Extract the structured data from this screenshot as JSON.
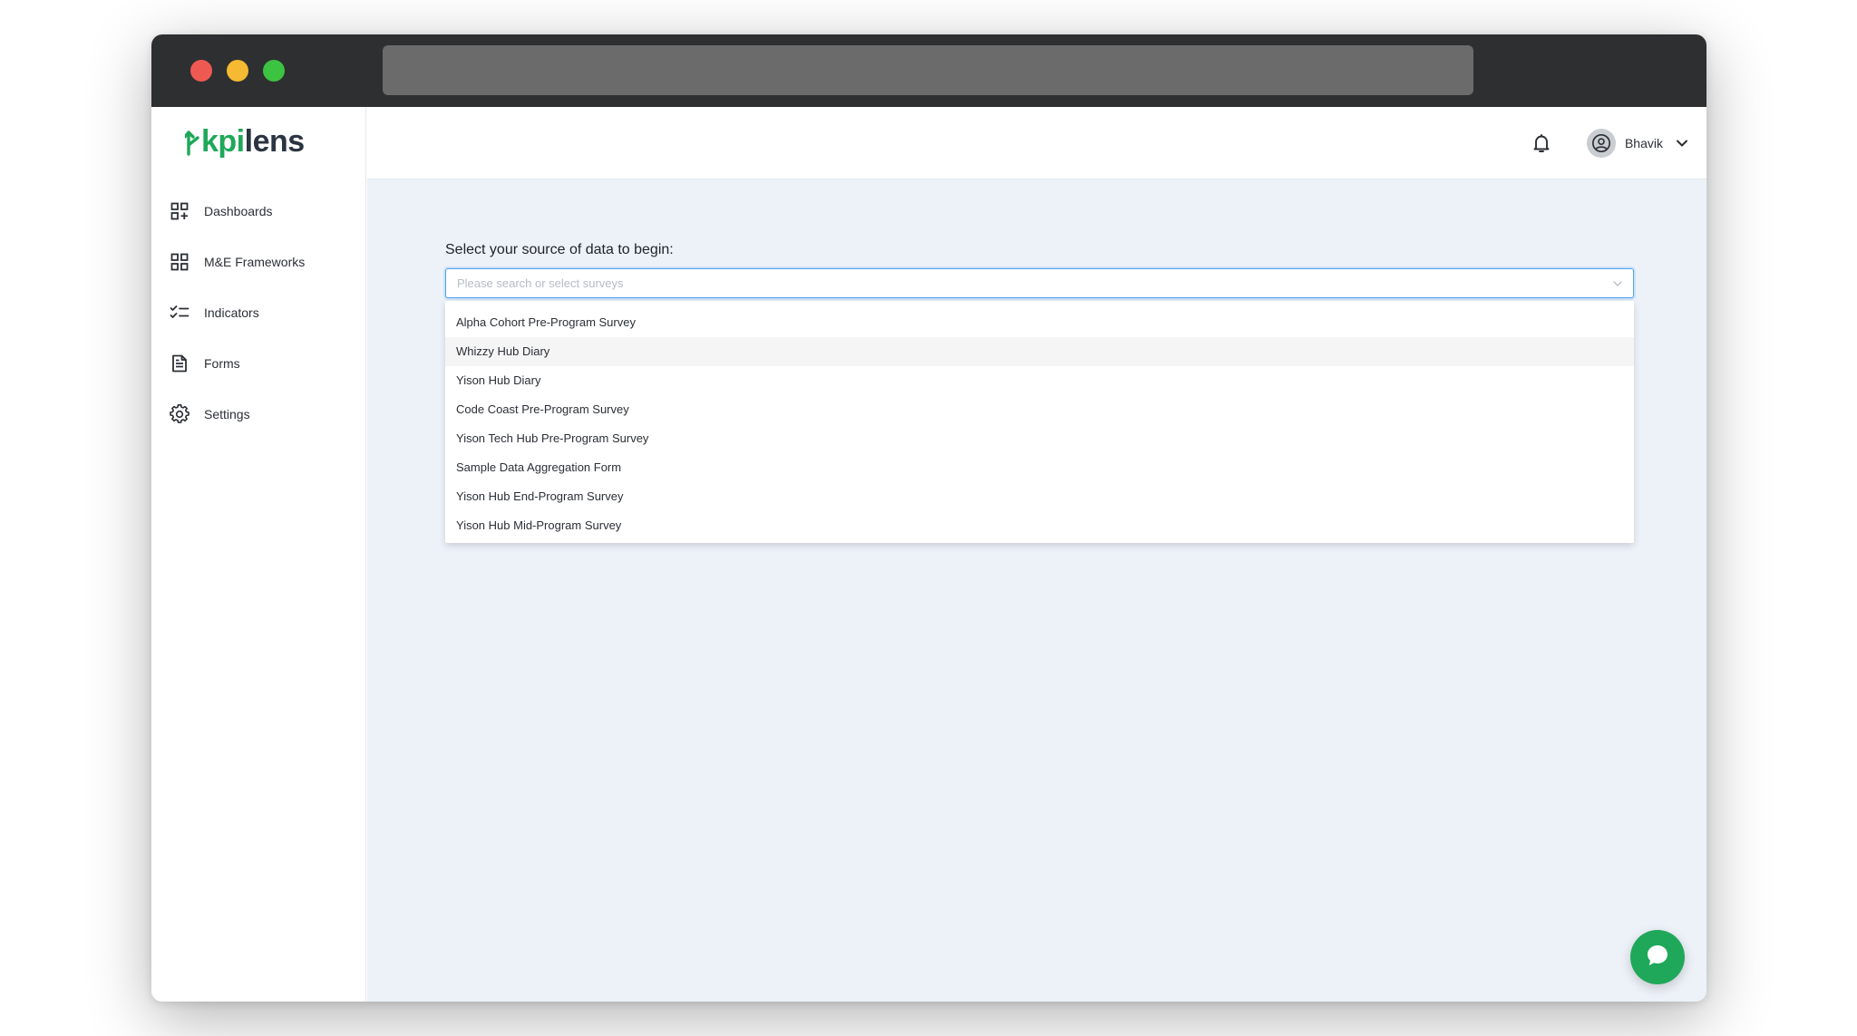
{
  "app": {
    "logo_prefix": "kpi",
    "logo_suffix": "lens",
    "brand_color": "#1fa85a"
  },
  "window": {
    "traffic_lights": [
      "close",
      "minimize",
      "maximize"
    ]
  },
  "sidebar": {
    "items": [
      {
        "label": "Dashboards",
        "icon": "dashboard-add-icon"
      },
      {
        "label": "M&E Frameworks",
        "icon": "grid-icon"
      },
      {
        "label": "Indicators",
        "icon": "checklist-icon"
      },
      {
        "label": "Forms",
        "icon": "document-icon"
      },
      {
        "label": "Settings",
        "icon": "gear-icon"
      }
    ]
  },
  "header": {
    "notification_icon": "bell-icon",
    "user": {
      "name": "Bhavik",
      "avatar_icon": "user-circle-icon",
      "caret_icon": "chevron-down-icon"
    }
  },
  "main": {
    "prompt": "Select your source of data to begin:",
    "select": {
      "placeholder": "Please search or select surveys",
      "value": "",
      "options": [
        "Alpha Cohort Pre-Program Survey",
        "Whizzy Hub Diary",
        "Yison Hub Diary",
        "Code Coast Pre-Program Survey",
        "Yison Tech Hub Pre-Program Survey",
        "Sample Data Aggregation Form",
        "Yison Hub End-Program Survey",
        "Yison Hub Mid-Program Survey"
      ],
      "hovered_option": "Whizzy Hub Diary"
    }
  },
  "chat": {
    "icon": "chat-bubble-icon"
  }
}
